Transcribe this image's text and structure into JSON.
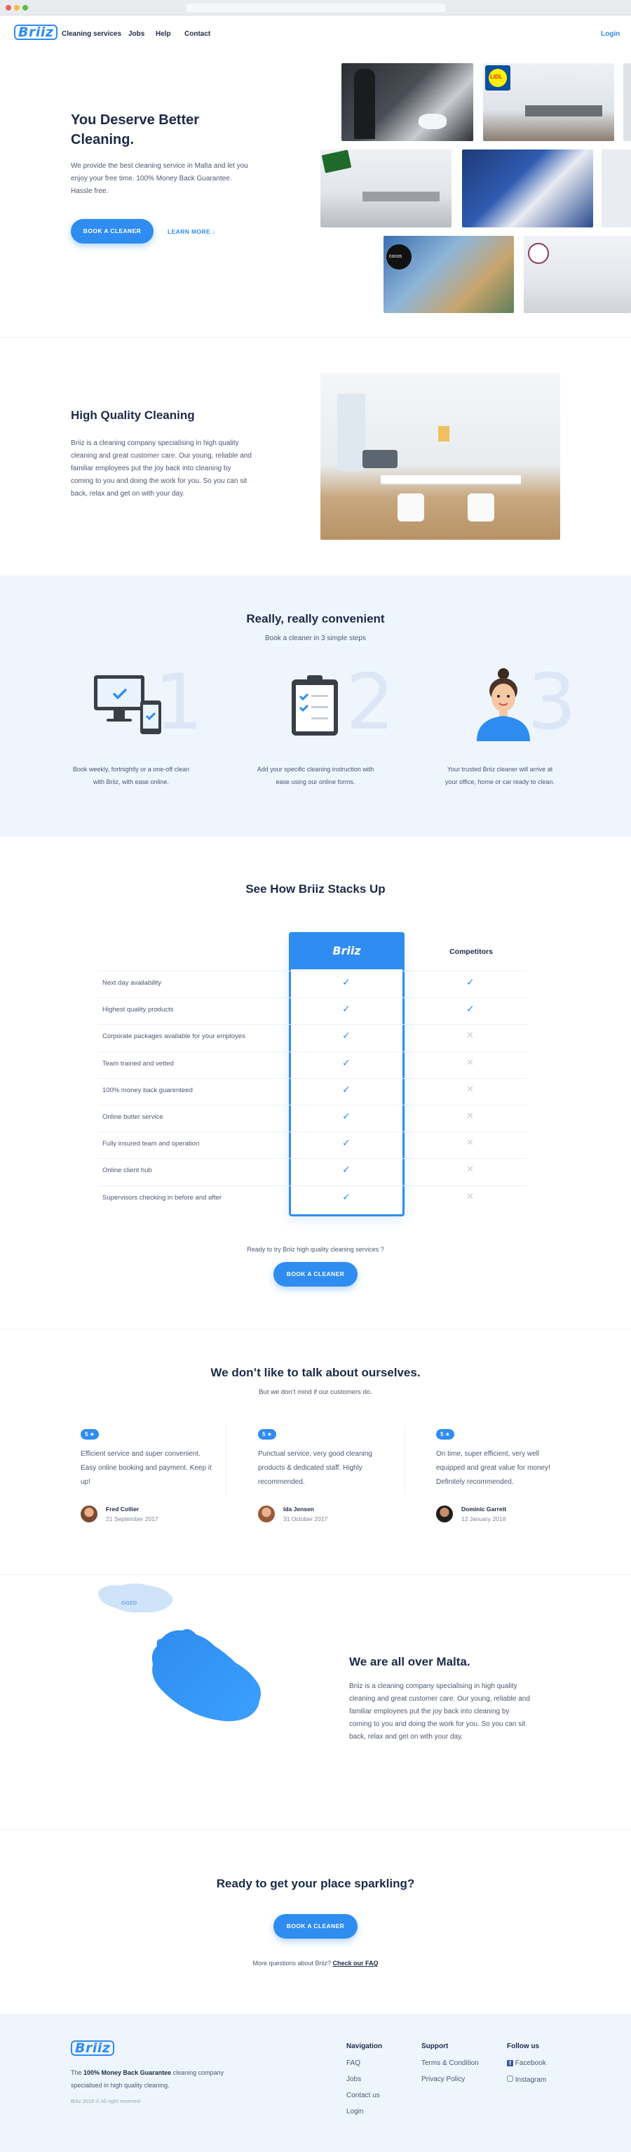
{
  "nav": {
    "logo": "Briiz",
    "links": [
      "Cleaning services",
      "Jobs",
      "Help",
      "Contact"
    ],
    "login": "Login"
  },
  "hero": {
    "title": "You Deserve Better Cleaning.",
    "text": "We provide the best cleaning service in Malta and let you enjoy your free time. 100% Money Back Guarantee. Hassle free.",
    "cta": "BOOK A CLEANER",
    "learn_more": "LEARN MORE"
  },
  "quality": {
    "title": "High Quality Cleaning",
    "text": "Briiz is a cleaning company specialising in high quality cleaning and great customer care. Our young, reliable and familiar employees put the joy back into cleaning by coming to you and doing the work for you. So you can sit back, relax and get on with your day."
  },
  "steps": {
    "title": "Really, really convenient",
    "subtitle": "Book a cleaner in 3 simple steps",
    "items": [
      {
        "num": "1",
        "text": "Book weekly, fortnightly or a one-off clean with Briiz, with ease online."
      },
      {
        "num": "2",
        "text": "Add your specific cleaning instruction with ease using our online forms."
      },
      {
        "num": "3",
        "text": "Your trusted Briiz cleaner will arrive at your office, home or car ready to clean."
      }
    ]
  },
  "compare": {
    "title": "See How Briiz Stacks Up",
    "brand_header": "Briiz",
    "competitor_header": "Competitors",
    "rows": [
      {
        "label": "Next day availability",
        "briiz": true,
        "competitors": true
      },
      {
        "label": "Highest quality products",
        "briiz": true,
        "competitors": true
      },
      {
        "label": "Corporate packages available for your employes",
        "briiz": true,
        "competitors": false
      },
      {
        "label": "Team trained and vetted",
        "briiz": true,
        "competitors": false
      },
      {
        "label": "100% money back guarenteed",
        "briiz": true,
        "competitors": false
      },
      {
        "label": "Online butler service",
        "briiz": true,
        "competitors": false
      },
      {
        "label": "Fully insured team and operation",
        "briiz": true,
        "competitors": false
      },
      {
        "label": "Online client hub",
        "briiz": true,
        "competitors": false
      },
      {
        "label": "Supervisors checking in before and after",
        "briiz": true,
        "competitors": false
      }
    ],
    "question": "Ready to try Briiz high quality cleaning services ?",
    "cta": "BOOK A CLEANER"
  },
  "reviews": {
    "title": "We don’t like to talk about ourselves.",
    "subtitle": "But we don’t mind if our customers do.",
    "items": [
      {
        "rating": "5 ★",
        "text": "Efficient service and super convenient. Easy online booking and payment. Keep it up!",
        "name": "Fred Collier",
        "date": "21 September 2017"
      },
      {
        "rating": "5 ★",
        "text": "Punctual service, very good cleaning products & dedicated staff. Highly recommended.",
        "name": "Ida Jensen",
        "date": "31 October 2017"
      },
      {
        "rating": "5 ★",
        "text": "On time, super efficient, very well equipped and great value for money! Definitely recommended.",
        "name": "Dominic Garrett",
        "date": "12 January 2018"
      }
    ]
  },
  "malta": {
    "title": "We are all over Malta.",
    "text": "Briiz is a cleaning company specialising in high quality cleaning and great customer care. Our young, reliable and familiar employees put the joy back into cleaning by coming to you and doing the work for you. So you can sit back, relax and get on with your day.",
    "gozo_label": "GOZO",
    "map_logo": "Briiz"
  },
  "cta_section": {
    "title": "Ready to get your place sparkling?",
    "button": "BOOK A CLEANER",
    "faq_prefix": "More questions about Briiz?",
    "faq_link": "Check our FAQ"
  },
  "footer": {
    "logo": "Briiz",
    "tagline_prefix": "The",
    "tagline_bold": "100% Money Back Guarantee",
    "tagline_suffix": "cleaning company specialised in high quality cleaning.",
    "copyright": "Briiz 2018 © All right reserved",
    "navigation_title": "Navigation",
    "navigation": [
      "FAQ",
      "Jobs",
      "Contact us",
      "Login"
    ],
    "support_title": "Support",
    "support": [
      "Terms & Condition",
      "Privacy Policy"
    ],
    "follow_title": "Follow us",
    "follow": [
      "Facebook",
      "Instagram"
    ]
  },
  "colors": {
    "accent": "#2f8cf0",
    "navy": "#1c2a48",
    "light_bg": "#eef5fd"
  }
}
